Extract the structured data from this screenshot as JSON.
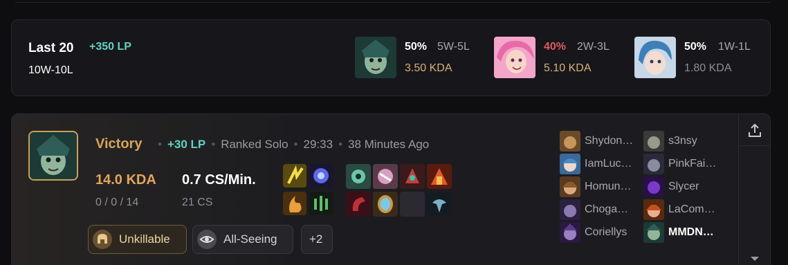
{
  "summary": {
    "title": "Last 20",
    "lp": "+350 LP",
    "record": "10W-10L",
    "champions": [
      {
        "icon": "green-masked-champion-icon",
        "winrate": "50%",
        "wl": "5W-5L",
        "kda": "3.50 KDA",
        "winrate_color": "#ffffff",
        "kda_color": "#d9b07a"
      },
      {
        "icon": "pink-haired-champion-icon",
        "winrate": "40%",
        "wl": "2W-3L",
        "kda": "5.10 KDA",
        "winrate_color": "#e05a5a",
        "kda_color": "#d9b07a"
      },
      {
        "icon": "blue-haired-champion-icon",
        "winrate": "50%",
        "wl": "1W-1L",
        "kda": "1.80 KDA",
        "winrate_color": "#ffffff",
        "kda_color": "#8e8e96"
      }
    ]
  },
  "match": {
    "result": "Victory",
    "lp": "+30 LP",
    "queue": "Ranked Solo",
    "duration": "29:33",
    "time_ago": "38 Minutes Ago",
    "kda": "14.0 KDA",
    "kda_detail": "0 / 0 / 14",
    "cs_per_min": "0.7 CS/Min.",
    "cs": "21 CS",
    "badges": [
      {
        "label": "Unkillable",
        "icon": "helmet-icon"
      },
      {
        "label": "All-Seeing",
        "icon": "eye-icon"
      }
    ],
    "more_badges": "+2",
    "team_left": [
      "Shydon…",
      "IamLuc…",
      "Homun…",
      "Choga…",
      "Coriellys"
    ],
    "team_right": [
      "s3nsy",
      "PinkFai…",
      "Slycer",
      "LaCom…",
      "MMDN…"
    ],
    "colors": {
      "result": "#d8a45a",
      "lp": "#5fd3c4",
      "kda": "#e5a55a"
    }
  }
}
